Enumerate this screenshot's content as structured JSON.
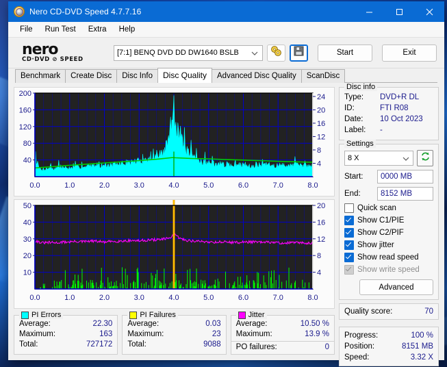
{
  "window": {
    "title": "Nero CD-DVD Speed 4.7.7.16",
    "minimize": "–",
    "maximize": "☐",
    "close": "✕"
  },
  "menu": [
    "File",
    "Run Test",
    "Extra",
    "Help"
  ],
  "logo": {
    "line1": "nero",
    "line2": "CD·DVD ⊘ SPEED"
  },
  "toolbar": {
    "drive": "[7:1]   BENQ DVD DD DW1640 BSLB",
    "disc_icon": "dual-disc-icon",
    "save_icon": "floppy-save-icon",
    "start_label": "Start",
    "exit_label": "Exit"
  },
  "tabs": [
    {
      "label": "Benchmark",
      "active": false
    },
    {
      "label": "Create Disc",
      "active": false
    },
    {
      "label": "Disc Info",
      "active": false
    },
    {
      "label": "Disc Quality",
      "active": true
    },
    {
      "label": "Advanced Disc Quality",
      "active": false
    },
    {
      "label": "ScanDisc",
      "active": false
    }
  ],
  "disc_info": {
    "title": "Disc info",
    "type_label": "Type:",
    "type_value": "DVD+R DL",
    "id_label": "ID:",
    "id_value": "FTI R08",
    "date_label": "Date:",
    "date_value": "10 Oct 2023",
    "label_label": "Label:",
    "label_value": "-"
  },
  "settings": {
    "title": "Settings",
    "speed": "8 X",
    "refresh_icon": "refresh-icon",
    "start_label": "Start:",
    "start_value": "0000 MB",
    "end_label": "End:",
    "end_value": "8152 MB",
    "checkboxes": [
      {
        "label": "Quick scan",
        "checked": false,
        "disabled": false
      },
      {
        "label": "Show C1/PIE",
        "checked": true,
        "disabled": false
      },
      {
        "label": "Show C2/PIF",
        "checked": true,
        "disabled": false
      },
      {
        "label": "Show jitter",
        "checked": true,
        "disabled": false
      },
      {
        "label": "Show read speed",
        "checked": true,
        "disabled": false
      },
      {
        "label": "Show write speed",
        "checked": true,
        "disabled": true
      }
    ],
    "advanced_label": "Advanced"
  },
  "quality": {
    "label": "Quality score:",
    "value": "70"
  },
  "status": {
    "progress_label": "Progress:",
    "progress_value": "100 %",
    "position_label": "Position:",
    "position_value": "8151 MB",
    "speed_label": "Speed:",
    "speed_value": "3.32 X"
  },
  "stats": [
    {
      "title": "PI Errors",
      "color": "#00ffff",
      "rows": [
        {
          "k": "Average:",
          "v": "22.30"
        },
        {
          "k": "Maximum:",
          "v": "163"
        },
        {
          "k": "Total:",
          "v": "727172"
        }
      ]
    },
    {
      "title": "PI Failures",
      "color": "#ffff00",
      "rows": [
        {
          "k": "Average:",
          "v": "0.03"
        },
        {
          "k": "Maximum:",
          "v": "23"
        },
        {
          "k": "Total:",
          "v": "9088"
        }
      ]
    },
    {
      "title": "Jitter",
      "color": "#ff00ff",
      "rows": [
        {
          "k": "Average:",
          "v": "10.50 %"
        },
        {
          "k": "Maximum:",
          "v": "13.9 %"
        }
      ],
      "extra": {
        "k": "PO failures:",
        "v": "0"
      }
    }
  ],
  "chart_data": [
    {
      "type": "area",
      "name": "pi-errors-chart",
      "title": "",
      "xlabel": "",
      "ylabel": "PI Errors",
      "xlim": [
        0.0,
        8.0
      ],
      "ylim": [
        0,
        200
      ],
      "y2lim": [
        0,
        25
      ],
      "xticks": [
        "0.0",
        "1.0",
        "2.0",
        "3.0",
        "4.0",
        "5.0",
        "6.0",
        "7.0",
        "8.0"
      ],
      "yticks": [
        "40",
        "80",
        "120",
        "160",
        "200"
      ],
      "y2ticks": [
        "4",
        "8",
        "12",
        "16",
        "20",
        "24"
      ],
      "grid": true,
      "background": "#222222",
      "gridcolor": "#0000cc",
      "series": [
        {
          "name": "PI Errors",
          "color": "#00ffff",
          "style": "area",
          "x": [
            0.0,
            0.05,
            0.1,
            0.18,
            0.25,
            0.35,
            0.45,
            0.55,
            0.7,
            0.85,
            1.0,
            1.15,
            1.3,
            1.45,
            1.6,
            1.8,
            2.0,
            2.2,
            2.4,
            2.6,
            2.8,
            3.0,
            3.2,
            3.4,
            3.55,
            3.7,
            3.8,
            3.88,
            3.93,
            3.97,
            4.0,
            4.03,
            4.07,
            4.12,
            4.2,
            4.3,
            4.45,
            4.6,
            4.8,
            5.0,
            5.2,
            5.4,
            5.6,
            5.8,
            6.0,
            6.2,
            6.4,
            6.6,
            6.8,
            7.0,
            7.2,
            7.4,
            7.6,
            7.8,
            8.0
          ],
          "y": [
            66,
            30,
            22,
            16,
            14,
            18,
            20,
            17,
            22,
            20,
            18,
            20,
            22,
            20,
            25,
            24,
            26,
            25,
            28,
            30,
            32,
            34,
            36,
            40,
            44,
            52,
            70,
            95,
            120,
            150,
            165,
            140,
            118,
            105,
            80,
            64,
            48,
            40,
            34,
            30,
            28,
            27,
            26,
            25,
            25,
            24,
            25,
            26,
            25,
            24,
            25,
            26,
            25,
            24,
            24
          ]
        },
        {
          "name": "Read speed",
          "color": "#00cc00",
          "style": "line",
          "x": [
            0.0,
            0.5,
            1.0,
            1.5,
            2.0,
            2.5,
            3.0,
            3.5,
            3.95,
            4.0,
            4.05,
            4.5,
            5.0,
            5.5,
            6.0,
            6.5,
            7.0,
            7.5,
            8.0
          ],
          "y2": [
            2.6,
            3.0,
            3.4,
            3.75,
            4.1,
            4.45,
            4.8,
            5.2,
            5.7,
            5.7,
            5.65,
            5.45,
            5.3,
            5.1,
            4.95,
            4.8,
            4.6,
            4.45,
            4.3
          ]
        }
      ],
      "layer_break": 4.0
    },
    {
      "type": "line",
      "name": "jitter-pif-chart",
      "title": "",
      "xlabel": "",
      "ylabel": "Jitter %",
      "xlim": [
        0.0,
        8.0
      ],
      "ylim": [
        0,
        50
      ],
      "y2lim": [
        0,
        20
      ],
      "xticks": [
        "0.0",
        "1.0",
        "2.0",
        "3.0",
        "4.0",
        "5.0",
        "6.0",
        "7.0",
        "8.0"
      ],
      "yticks": [
        "10",
        "20",
        "30",
        "40",
        "50"
      ],
      "y2ticks": [
        "4",
        "8",
        "12",
        "16",
        "20"
      ],
      "grid": true,
      "background": "#222222",
      "gridcolor": "#0000cc",
      "series": [
        {
          "name": "Jitter",
          "color": "#ff00ff",
          "style": "line",
          "x": [
            0.0,
            0.2,
            0.4,
            0.6,
            0.8,
            1.0,
            1.2,
            1.4,
            1.6,
            1.8,
            2.0,
            2.2,
            2.4,
            2.6,
            2.8,
            3.0,
            3.2,
            3.4,
            3.6,
            3.8,
            3.95,
            4.0,
            4.05,
            4.2,
            4.4,
            4.6,
            4.8,
            5.0,
            5.2,
            5.4,
            5.6,
            5.8,
            6.0,
            6.2,
            6.4,
            6.6,
            6.8,
            7.0,
            7.2,
            7.4,
            7.6,
            7.8,
            8.0
          ],
          "y": [
            29,
            27.5,
            27.8,
            27.6,
            28.0,
            28.2,
            28.4,
            28.3,
            28.6,
            28.5,
            28.0,
            28.4,
            28.6,
            28.8,
            29.0,
            28.8,
            29.2,
            29.4,
            29.6,
            30.0,
            31.5,
            33.5,
            32.0,
            30.0,
            29.0,
            28.6,
            28.4,
            28.2,
            28.0,
            28.2,
            28.0,
            27.8,
            28.0,
            28.2,
            28.0,
            27.8,
            28.0,
            27.6,
            27.4,
            27.8,
            27.6,
            27.4,
            27.8
          ]
        },
        {
          "name": "PI Failures",
          "color": "#00ff00",
          "style": "impulse",
          "peak_at": 4.0,
          "peak_value": 23
        }
      ],
      "layer_break": 4.0
    }
  ]
}
